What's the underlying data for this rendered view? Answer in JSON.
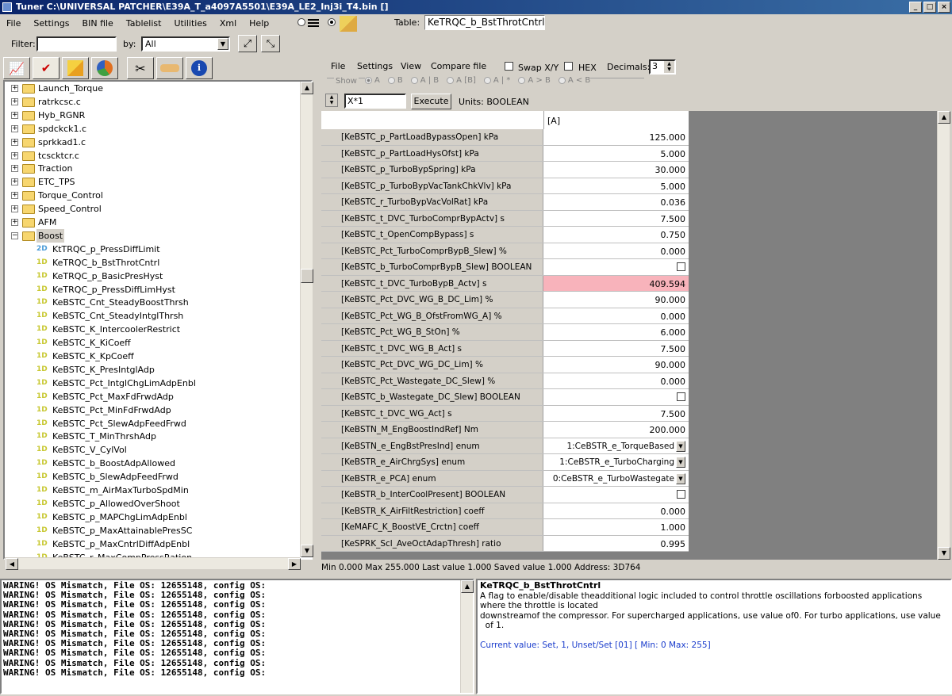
{
  "window": {
    "title": "Tuner C:\\UNIVERSAL PATCHER\\E39A_T_a4097A5501\\E39A_LE2_Inj3i_T4.bin []",
    "buttons": [
      "_",
      "□",
      "×"
    ]
  },
  "menu": {
    "items": [
      "File",
      "Settings",
      "BIN file",
      "Tablelist",
      "Utilities",
      "Xml",
      "Help"
    ]
  },
  "table": {
    "label": "Table:",
    "name": "KeTRQC_b_BstThrotCntrl"
  },
  "filter": {
    "label": "Filter:",
    "value": "",
    "by_label": "by:",
    "by_value": "All"
  },
  "tree": {
    "groups": [
      "Launch_Torque",
      "ratrkcsc.c",
      "Hyb_RGNR",
      "spdckck1.c",
      "sprkkad1.c",
      "tcscktcr.c",
      "Traction",
      "ETC_TPS",
      "Torque_Control",
      "Speed_Control",
      "AFM",
      "Boost"
    ],
    "boost_items": [
      {
        "dim": "2D",
        "label": "KtTRQC_p_PressDiffLimit"
      },
      {
        "dim": "1D",
        "label": "KeTRQC_b_BstThrotCntrl"
      },
      {
        "dim": "1D",
        "label": "KeTRQC_p_BasicPresHyst"
      },
      {
        "dim": "1D",
        "label": "KeTRQC_p_PressDiffLimHyst"
      },
      {
        "dim": "1D",
        "label": "KeBSTC_Cnt_SteadyBoostThrsh"
      },
      {
        "dim": "1D",
        "label": "KeBSTC_Cnt_SteadyIntglThrsh"
      },
      {
        "dim": "1D",
        "label": "KeBSTC_K_IntercoolerRestrict"
      },
      {
        "dim": "1D",
        "label": "KeBSTC_K_KiCoeff"
      },
      {
        "dim": "1D",
        "label": "KeBSTC_K_KpCoeff"
      },
      {
        "dim": "1D",
        "label": "KeBSTC_K_PresIntglAdp"
      },
      {
        "dim": "1D",
        "label": "KeBSTC_Pct_IntglChgLimAdpEnbl"
      },
      {
        "dim": "1D",
        "label": "KeBSTC_Pct_MaxFdFrwdAdp"
      },
      {
        "dim": "1D",
        "label": "KeBSTC_Pct_MinFdFrwdAdp"
      },
      {
        "dim": "1D",
        "label": "KeBSTC_Pct_SlewAdpFeedFrwd"
      },
      {
        "dim": "1D",
        "label": "KeBSTC_T_MinThrshAdp"
      },
      {
        "dim": "1D",
        "label": "KeBSTC_V_CylVol"
      },
      {
        "dim": "1D",
        "label": "KeBSTC_b_BoostAdpAllowed"
      },
      {
        "dim": "1D",
        "label": "KeBSTC_b_SlewAdpFeedFrwd"
      },
      {
        "dim": "1D",
        "label": "KeBSTC_m_AirMaxTurboSpdMin"
      },
      {
        "dim": "1D",
        "label": "KeBSTC_p_AllowedOverShoot"
      },
      {
        "dim": "1D",
        "label": "KeBSTC_p_MAPChgLimAdpEnbl"
      },
      {
        "dim": "1D",
        "label": "KeBSTC_p_MaxAttainablePresSC"
      },
      {
        "dim": "1D",
        "label": "KeBSTC_p_MaxCntrlDiffAdpEnbl"
      },
      {
        "dim": "1D",
        "label": "KeBSTC_r_MaxCompPressRation"
      }
    ]
  },
  "editor": {
    "menu": [
      "File",
      "Settings",
      "View",
      "Compare file"
    ],
    "swap_label": "Swap X/Y",
    "hex_label": "HEX",
    "decimals_label": "Decimals:",
    "decimals_value": "3",
    "show_label": "Show",
    "show_options": [
      "A",
      "B",
      "A | B",
      "A [B]",
      "A | *",
      "A > B",
      "A < B"
    ],
    "expr_value": "X*1",
    "execute_label": "Execute",
    "units": "Units: BOOLEAN",
    "column_header": "[A]",
    "rows": [
      {
        "name": "[KeBSTC_p_PartLoadBypassOpen] kPa",
        "value": "125.000",
        "type": "num"
      },
      {
        "name": "[KeBSTC_p_PartLoadHysOfst] kPa",
        "value": "5.000",
        "type": "num"
      },
      {
        "name": "[KeBSTC_p_TurboBypSpring] kPa",
        "value": "30.000",
        "type": "num"
      },
      {
        "name": "[KeBSTC_p_TurboBypVacTankChkVlv] kPa",
        "value": "5.000",
        "type": "num"
      },
      {
        "name": "[KeBSTC_r_TurboBypVacVolRat] kPa",
        "value": "0.036",
        "type": "num"
      },
      {
        "name": "[KeBSTC_t_DVC_TurboComprBypActv] s",
        "value": "7.500",
        "type": "num"
      },
      {
        "name": "[KeBSTC_t_OpenCompBypass] s",
        "value": "0.750",
        "type": "num"
      },
      {
        "name": "[KeBSTC_Pct_TurboComprBypB_Slew] %",
        "value": "0.000",
        "type": "num"
      },
      {
        "name": "[KeBSTC_b_TurboComprBypB_Slew] BOOLEAN",
        "value": "",
        "type": "chk"
      },
      {
        "name": "[KeBSTC_t_DVC_TurboBypB_Actv] s",
        "value": "409.594",
        "type": "num",
        "highlight": true
      },
      {
        "name": "[KeBSTC_Pct_DVC_WG_B_DC_Lim] %",
        "value": "90.000",
        "type": "num"
      },
      {
        "name": "[KeBSTC_Pct_WG_B_OfstFromWG_A] %",
        "value": "0.000",
        "type": "num"
      },
      {
        "name": "[KeBSTC_Pct_WG_B_StOn] %",
        "value": "6.000",
        "type": "num"
      },
      {
        "name": "[KeBSTC_t_DVC_WG_B_Act] s",
        "value": "7.500",
        "type": "num"
      },
      {
        "name": "[KeBSTC_Pct_DVC_WG_DC_Lim] %",
        "value": "90.000",
        "type": "num"
      },
      {
        "name": "[KeBSTC_Pct_Wastegate_DC_Slew] %",
        "value": "0.000",
        "type": "num"
      },
      {
        "name": "[KeBSTC_b_Wastegate_DC_Slew] BOOLEAN",
        "value": "",
        "type": "chk"
      },
      {
        "name": "[KeBSTC_t_DVC_WG_Act] s",
        "value": "7.500",
        "type": "num"
      },
      {
        "name": "[KeBSTN_M_EngBoostIndRef] Nm",
        "value": "200.000",
        "type": "num"
      },
      {
        "name": "[KeBSTN_e_EngBstPresInd] enum",
        "value": "1:CeBSTR_e_TorqueBased",
        "type": "dd"
      },
      {
        "name": "[KeBSTR_e_AirChrgSys] enum",
        "value": "1:CeBSTR_e_TurboCharging",
        "type": "dd"
      },
      {
        "name": "[KeBSTR_e_PCA] enum",
        "value": "0:CeBSTR_e_TurboWastegate",
        "type": "dd"
      },
      {
        "name": "[KeBSTR_b_InterCoolPresent] BOOLEAN",
        "value": "",
        "type": "chk"
      },
      {
        "name": "[KeBSTR_K_AirFiltRestriction] coeff",
        "value": "0.000",
        "type": "num"
      },
      {
        "name": "[KeMAFC_K_BoostVE_Crctn] coeff",
        "value": "1.000",
        "type": "num"
      },
      {
        "name": "[KeSPRK_Scl_AveOctAdapThresh] ratio",
        "value": "0.995",
        "type": "num"
      }
    ],
    "status": "Min 0.000 Max 255.000 Last value 1.000 Saved value 1.000 Address: 3D764"
  },
  "log": {
    "lines": [
      "WARING! OS Mismatch, File OS: 12655148, config OS:",
      "WARING! OS Mismatch, File OS: 12655148, config OS:",
      "WARING! OS Mismatch, File OS: 12655148, config OS:",
      "WARING! OS Mismatch, File OS: 12655148, config OS:",
      "WARING! OS Mismatch, File OS: 12655148, config OS:",
      "WARING! OS Mismatch, File OS: 12655148, config OS:",
      "WARING! OS Mismatch, File OS: 12655148, config OS:",
      "WARING! OS Mismatch, File OS: 12655148, config OS:",
      "WARING! OS Mismatch, File OS: 12655148, config OS:",
      "WARING! OS Mismatch, File OS: 12655148, config OS:"
    ]
  },
  "info": {
    "title": "KeTRQC_b_BstThrotCntrl",
    "description_lines": [
      "A flag to enable/disable theadditional logic included to control throttle oscillations forboosted applications where the throttle is located",
      "downstreamof the compressor. For supercharged applications, use value of0. For turbo applications, use value",
      "  of 1."
    ],
    "current": "Current value: Set, 1, Unset/Set [01] [ Min: 0 Max: 255]"
  }
}
